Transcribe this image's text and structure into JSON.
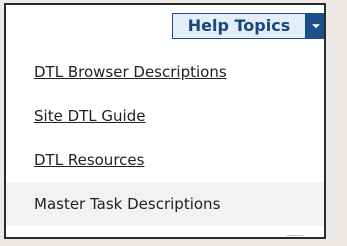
{
  "help_menu": {
    "toggle_label": "Help Topics",
    "caret_icon": "chevron-down-icon",
    "items": [
      {
        "label": "DTL Browser Descriptions",
        "active": false
      },
      {
        "label": "Site DTL Guide",
        "active": false
      },
      {
        "label": "DTL Resources",
        "active": false
      },
      {
        "label": "Master Task Descriptions",
        "active": true
      }
    ]
  }
}
